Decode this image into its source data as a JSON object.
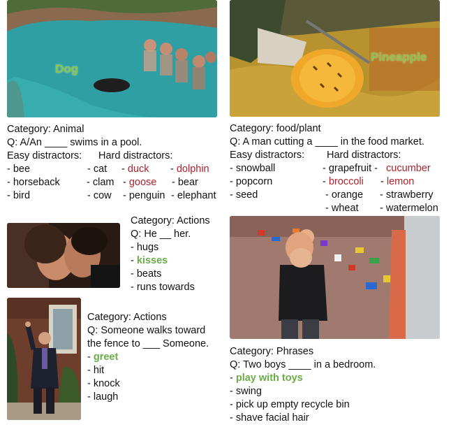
{
  "panel_dog": {
    "overlay": "Dog",
    "category": "Category: Animal",
    "question": "Q: A/An ____ swims in a pool.",
    "header_easy": "Easy distractors:",
    "header_hard": "Hard distractors:",
    "easy": [
      "- bee",
      "- horseback",
      "- bird"
    ],
    "easy2": [
      "- cat",
      "- clam",
      "- cow"
    ],
    "hard1": [
      "duck",
      "goose",
      "penguin"
    ],
    "hard2": [
      "dolphin",
      "bear",
      "elephant"
    ]
  },
  "panel_pineapple": {
    "overlay": "Pineapple",
    "category": "Category: food/plant",
    "question": "Q: A  man cutting a ____ in the food market.",
    "header_easy": "Easy distractors:",
    "header_hard": "Hard distractors:",
    "easy": [
      "- snowball",
      "- popcorn",
      "- seed"
    ],
    "hard1": [
      "grapefruit",
      "broccoli",
      "orange",
      "wheat"
    ],
    "hard2": [
      "cucumber",
      "lemon",
      "strawberry",
      "watermelon"
    ]
  },
  "panel_kiss": {
    "category": "Category: Actions",
    "question": "Q: He __ her.",
    "options": [
      "- hugs",
      "kisses",
      "- beats",
      "- runs towards"
    ]
  },
  "panel_wave": {
    "category": "Category: Actions",
    "question_line1": "Q:  Someone walks toward",
    "question_line2": "the fence to ___ Someone.",
    "options": [
      "greet",
      "- hit",
      "- knock",
      "- laugh"
    ]
  },
  "panel_toys": {
    "category": "Category: Phrases",
    "question": "Q: Two boys ____ in a bedroom.",
    "options": [
      "play with toys",
      "- swing",
      "- pick up empty recycle bin",
      "- shave facial hair"
    ]
  },
  "colors": {
    "hard": "#b0222c",
    "answer": "#6aad45"
  }
}
